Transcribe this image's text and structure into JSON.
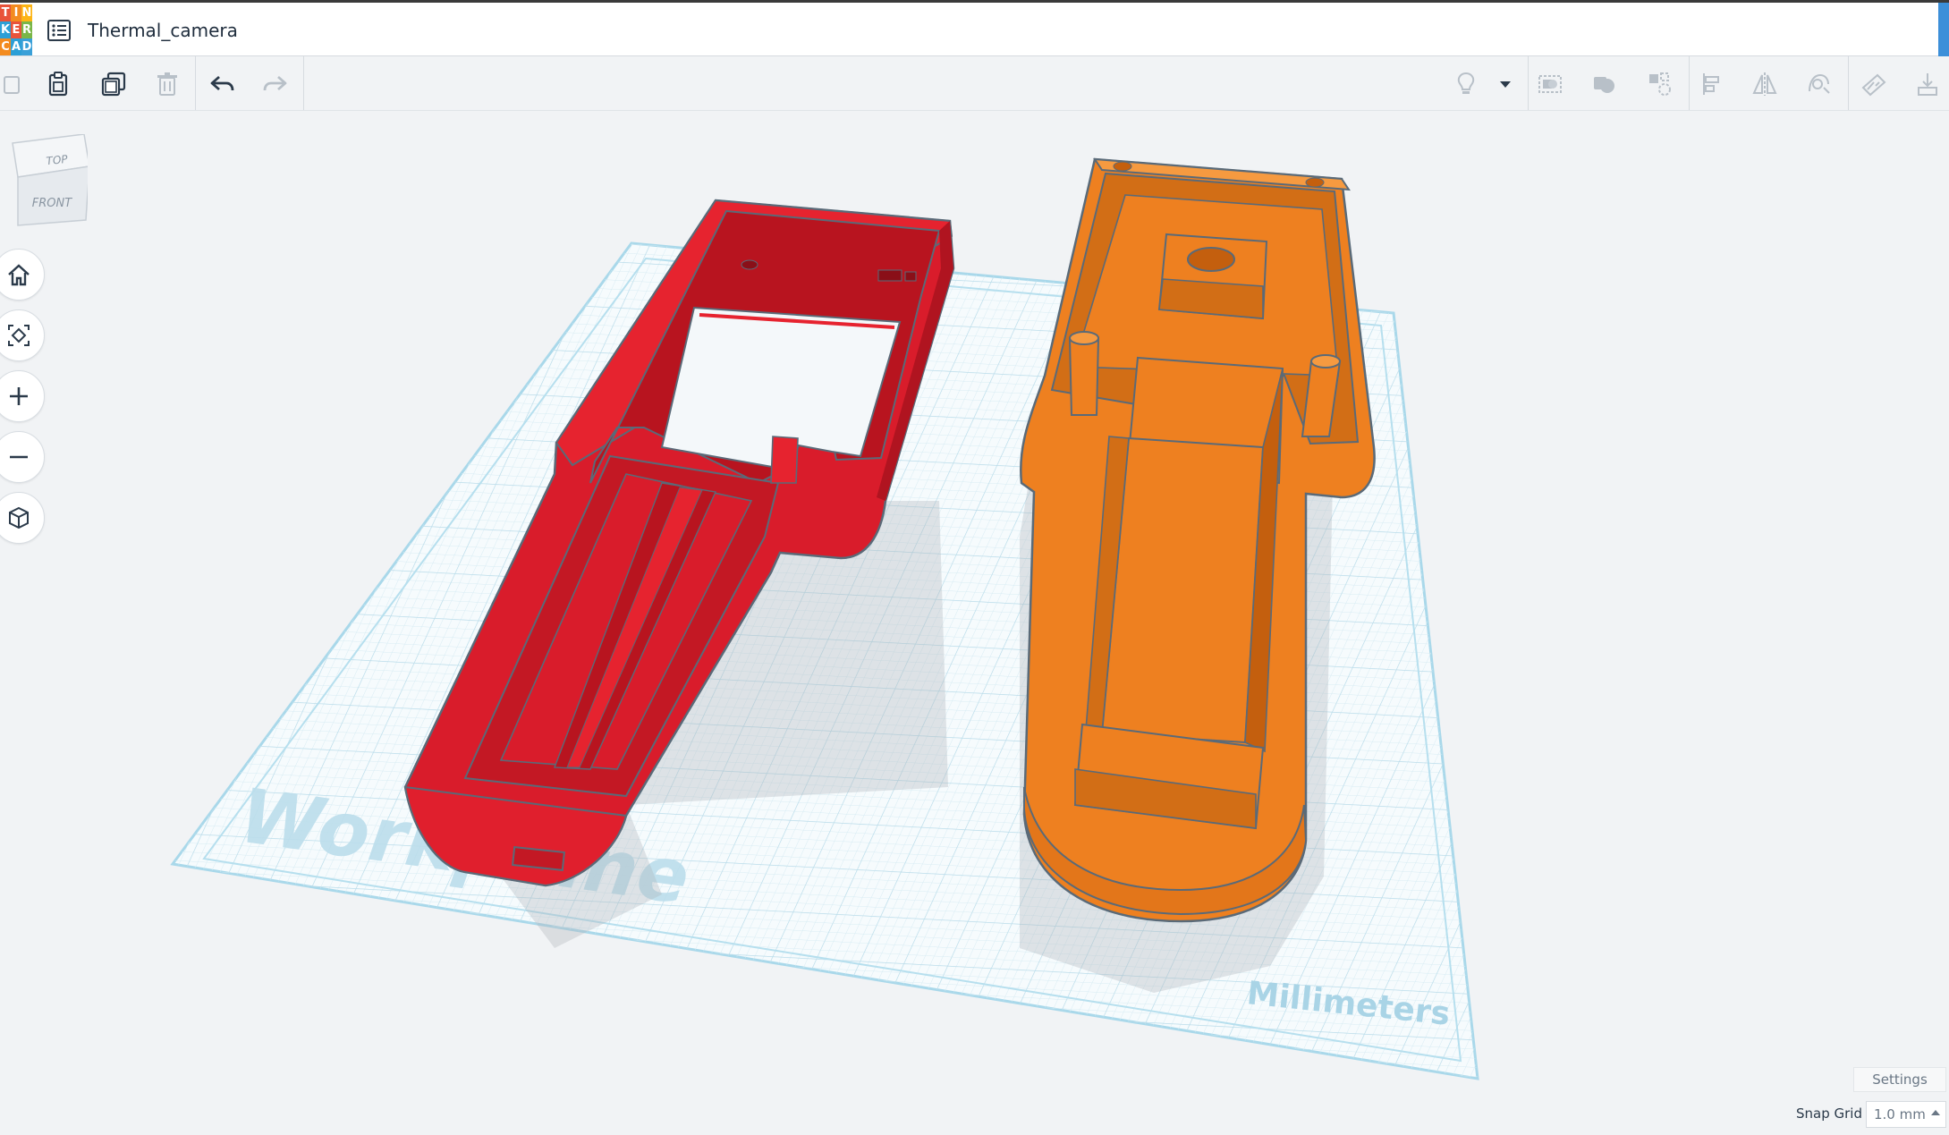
{
  "app": {
    "logo_letters": [
      "T",
      "I",
      "N",
      "K",
      "E",
      "R",
      "C",
      "A",
      "D"
    ],
    "logo_colors": [
      "#e8533a",
      "#f38b1f",
      "#fdb515",
      "#2c9fd6",
      "#e8533a",
      "#7ab648",
      "#f38b1f",
      "#2c9fd6",
      "#3aa0d8"
    ],
    "document_title": "Thermal_camera"
  },
  "toolbar": {
    "left_tools": [
      {
        "name": "copy-icon",
        "interactable": true
      },
      {
        "name": "paste-icon",
        "interactable": true
      },
      {
        "name": "duplicate-icon",
        "interactable": true
      },
      {
        "name": "delete-icon",
        "interactable": true
      },
      {
        "name": "undo-icon",
        "interactable": true
      },
      {
        "name": "redo-icon",
        "interactable": true
      }
    ],
    "right_tools": [
      "lightbulb-icon",
      "dropdown-caret-icon",
      "group-icon",
      "solid-icon",
      "hole-icon",
      "align-icon",
      "mirror-icon",
      "workplane-icon",
      "ruler-icon",
      "import-icon"
    ]
  },
  "viewcube": {
    "top_label": "TOP",
    "front_label": "FRONT"
  },
  "nav": [
    "home-icon",
    "fit-icon",
    "zoom-in-icon",
    "zoom-out-icon",
    "perspective-icon"
  ],
  "workplane": {
    "watermark": "Workplane",
    "units_label": "Millimeters",
    "colors": {
      "plane": "#f6fbfd",
      "grid": "#c8e4ef",
      "border": "#a9d8ea",
      "red_part": "#e01f2d",
      "orange_part": "#ee8020"
    }
  },
  "footer": {
    "settings_label": "Settings",
    "snap_grid_label": "Snap Grid",
    "snap_grid_value": "1.0 mm"
  }
}
